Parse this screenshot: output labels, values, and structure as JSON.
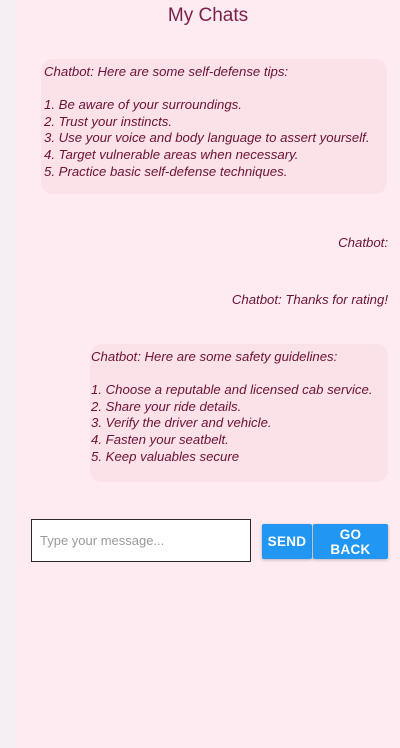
{
  "header": {
    "title": "My Chats"
  },
  "messages": [
    {
      "text": "Chatbot: Here are some self-defense tips:\n\n1. Be aware of your surroundings.\n2. Trust your instincts.\n3. Use your voice and body language to assert yourself.\n4. Target vulnerable areas when necessary.\n5. Practice basic self-defense techniques."
    },
    {
      "text": "Chatbot:"
    },
    {
      "text": "Chatbot: Thanks for rating!"
    },
    {
      "text": "Chatbot: Here are some safety guidelines:\n\n1. Choose a reputable and licensed cab service.\n2. Share your ride details.\n3. Verify the driver and vehicle.\n4. Fasten your seatbelt.\n5. Keep valuables secure"
    }
  ],
  "composer": {
    "placeholder": "Type your message...",
    "value": "",
    "send_label": "SEND",
    "back_label": "GO BACK"
  },
  "colors": {
    "background": "#fdebf1",
    "bubble": "#fbe1e8",
    "text": "#6b1235",
    "button": "#2196f3"
  }
}
